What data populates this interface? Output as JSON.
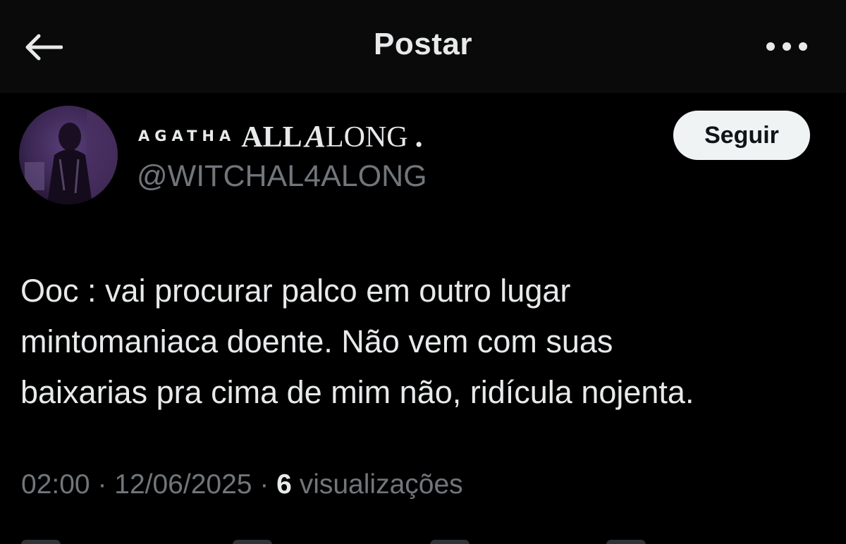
{
  "header": {
    "back_icon": "arrow-left-icon",
    "title": "Postar",
    "more_icon": "more-horizontal-icon"
  },
  "author": {
    "display_name_part1": "AGATHA",
    "display_name_part2": "ALL",
    "display_name_part3_fancy": "A",
    "display_name_part3_rest": "LONG",
    "display_name_part4": ".",
    "handle": "@WITCHAL4ALONG",
    "avatar_icon": "avatar"
  },
  "follow_button": {
    "label": "Seguir"
  },
  "post": {
    "text": "Ooc : vai procurar palco em outro lugar\nmintomaniaca doente. Não vem com suas\nbaixarias pra cima de mim não, ridícula nojenta."
  },
  "meta": {
    "time": "02:00",
    "sep1": " · ",
    "date": "12/06/2025",
    "sep2": " · ",
    "views_count": "6",
    "views_label": " visualizações"
  },
  "colors": {
    "background": "#000000",
    "header_background": "#0a0a0a",
    "primary_text": "#e7e9ea",
    "secondary_text": "#71767b",
    "button_background": "#eff3f4",
    "button_text": "#0f1419"
  }
}
